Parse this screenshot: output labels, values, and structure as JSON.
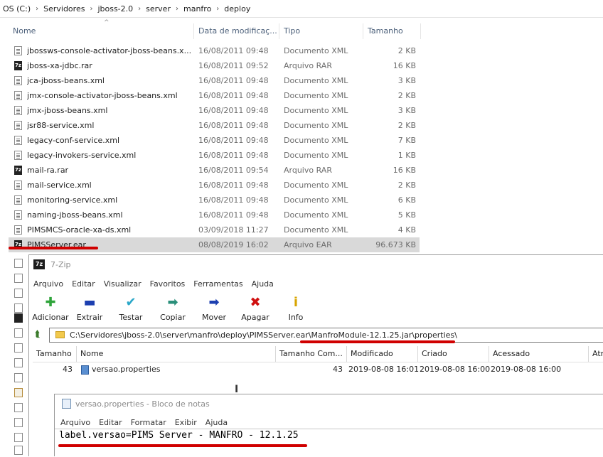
{
  "colors": {
    "accent_red": "#d00000",
    "selection": "#d9d9d9"
  },
  "explorer": {
    "breadcrumb": [
      "OS (C:)",
      "Servidores",
      "jboss-2.0",
      "server",
      "manfro",
      "deploy"
    ],
    "columns": {
      "name": "Nome",
      "date": "Data de modificaç...",
      "type": "Tipo",
      "size": "Tamanho"
    },
    "files": [
      {
        "name": "jbossws-console-activator-jboss-beans.x...",
        "date": "16/08/2011 09:48",
        "type": "Documento XML",
        "size": "2 KB",
        "icon": "xml-file-icon"
      },
      {
        "name": "jboss-xa-jdbc.rar",
        "date": "16/08/2011 09:52",
        "type": "Arquivo RAR",
        "size": "16 KB",
        "icon": "7zip-archive-icon"
      },
      {
        "name": "jca-jboss-beans.xml",
        "date": "16/08/2011 09:48",
        "type": "Documento XML",
        "size": "3 KB",
        "icon": "xml-file-icon"
      },
      {
        "name": "jmx-console-activator-jboss-beans.xml",
        "date": "16/08/2011 09:48",
        "type": "Documento XML",
        "size": "2 KB",
        "icon": "xml-file-icon"
      },
      {
        "name": "jmx-jboss-beans.xml",
        "date": "16/08/2011 09:48",
        "type": "Documento XML",
        "size": "3 KB",
        "icon": "xml-file-icon"
      },
      {
        "name": "jsr88-service.xml",
        "date": "16/08/2011 09:48",
        "type": "Documento XML",
        "size": "2 KB",
        "icon": "xml-file-icon"
      },
      {
        "name": "legacy-conf-service.xml",
        "date": "16/08/2011 09:48",
        "type": "Documento XML",
        "size": "7 KB",
        "icon": "xml-file-icon"
      },
      {
        "name": "legacy-invokers-service.xml",
        "date": "16/08/2011 09:48",
        "type": "Documento XML",
        "size": "1 KB",
        "icon": "xml-file-icon"
      },
      {
        "name": "mail-ra.rar",
        "date": "16/08/2011 09:54",
        "type": "Arquivo RAR",
        "size": "16 KB",
        "icon": "7zip-archive-icon"
      },
      {
        "name": "mail-service.xml",
        "date": "16/08/2011 09:48",
        "type": "Documento XML",
        "size": "2 KB",
        "icon": "xml-file-icon"
      },
      {
        "name": "monitoring-service.xml",
        "date": "16/08/2011 09:48",
        "type": "Documento XML",
        "size": "6 KB",
        "icon": "xml-file-icon"
      },
      {
        "name": "naming-jboss-beans.xml",
        "date": "16/08/2011 09:48",
        "type": "Documento XML",
        "size": "5 KB",
        "icon": "xml-file-icon"
      },
      {
        "name": "PIMSMCS-oracle-xa-ds.xml",
        "date": "03/09/2018 11:27",
        "type": "Documento XML",
        "size": "4 KB",
        "icon": "xml-file-icon"
      },
      {
        "name": "PIMSServer.ear",
        "date": "08/08/2019 16:02",
        "type": "Arquivo EAR",
        "size": "96.673 KB",
        "icon": "7zip-archive-icon",
        "selected": true
      }
    ]
  },
  "sevenzip": {
    "title": "7-Zip",
    "menu": [
      "Arquivo",
      "Editar",
      "Visualizar",
      "Favoritos",
      "Ferramentas",
      "Ajuda"
    ],
    "toolbar": [
      {
        "label": "Adicionar",
        "icon": "plus-icon",
        "glyph": "✚",
        "color": "#2ea43a"
      },
      {
        "label": "Extrair",
        "icon": "minus-icon",
        "glyph": "▬",
        "color": "#1c3fb0"
      },
      {
        "label": "Testar",
        "icon": "check-icon",
        "glyph": "✔",
        "color": "#2aa7c8"
      },
      {
        "label": "Copiar",
        "icon": "copy-arrow-icon",
        "glyph": "➡",
        "color": "#2a8f7a"
      },
      {
        "label": "Mover",
        "icon": "move-arrow-icon",
        "glyph": "➡",
        "color": "#1c3fb0"
      },
      {
        "label": "Apagar",
        "icon": "delete-x-icon",
        "glyph": "✖",
        "color": "#d01010"
      },
      {
        "label": "Info",
        "icon": "info-icon",
        "glyph": "i",
        "color": "#d8a400"
      }
    ],
    "address": "C:\\Servidores\\jboss-2.0\\server\\manfro\\deploy\\PIMSServer.ear\\ManfroModule-12.1.25.jar\\properties\\",
    "columns": [
      "Tamanho",
      "Nome",
      "Tamanho Com...",
      "Modificado",
      "Criado",
      "Acessado",
      "Atri"
    ],
    "row": {
      "size": "43",
      "name": "versao.properties",
      "packed_size": "43",
      "modified": "2019-08-08 16:01",
      "created": "2019-08-08 16:00",
      "accessed": "2019-08-08 16:00"
    }
  },
  "notepad": {
    "title": "versao.properties - Bloco de notas",
    "menu": [
      "Arquivo",
      "Editar",
      "Formatar",
      "Exibir",
      "Ajuda"
    ],
    "content": "label.versao=PIMS Server - MANFRO - 12.1.25"
  }
}
